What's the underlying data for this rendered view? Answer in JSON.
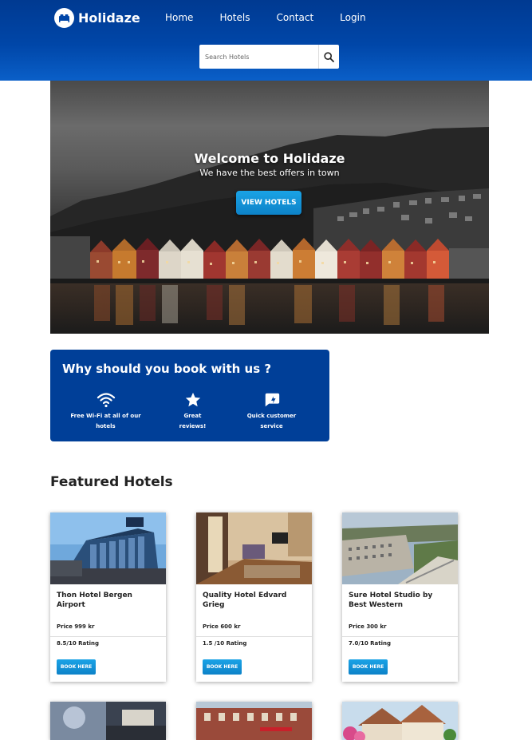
{
  "header": {
    "brand": "Holidaze",
    "nav": [
      {
        "label": "Home"
      },
      {
        "label": "Hotels"
      },
      {
        "label": "Contact"
      },
      {
        "label": "Login"
      }
    ],
    "search": {
      "placeholder": "Search Hotels",
      "value": ""
    }
  },
  "hero": {
    "title": "Welcome to Holidaze",
    "subtitle": "We have the best offers in town",
    "button_label": "VIEW HOTELS"
  },
  "why": {
    "title": "Why should you book with us ?",
    "items": [
      {
        "label": "Free Wi-Fi at all of our hotels",
        "icon": "wifi-icon"
      },
      {
        "label": "Great reviews!",
        "icon": "star-icon"
      },
      {
        "label": "Quick customer service",
        "icon": "chat-icon"
      }
    ]
  },
  "featured": {
    "title": "Featured Hotels",
    "hotels": [
      {
        "name": "Thon Hotel Bergen Airport",
        "price": "Price 999 kr",
        "rating": "8.5/10 Rating",
        "book_label": "BOOK HERE"
      },
      {
        "name": "Quality Hotel Edvard Grieg",
        "price": "Price 600 kr",
        "rating": "1.5 /10 Rating",
        "book_label": "BOOK HERE"
      },
      {
        "name": "Sure Hotel Studio by Best Western",
        "price": "Price 300 kr",
        "rating": "7.0/10 Rating",
        "book_label": "BOOK HERE"
      }
    ]
  },
  "colors": {
    "header": "#0046a8",
    "why_box": "#003f98",
    "button": "#1395d8"
  }
}
